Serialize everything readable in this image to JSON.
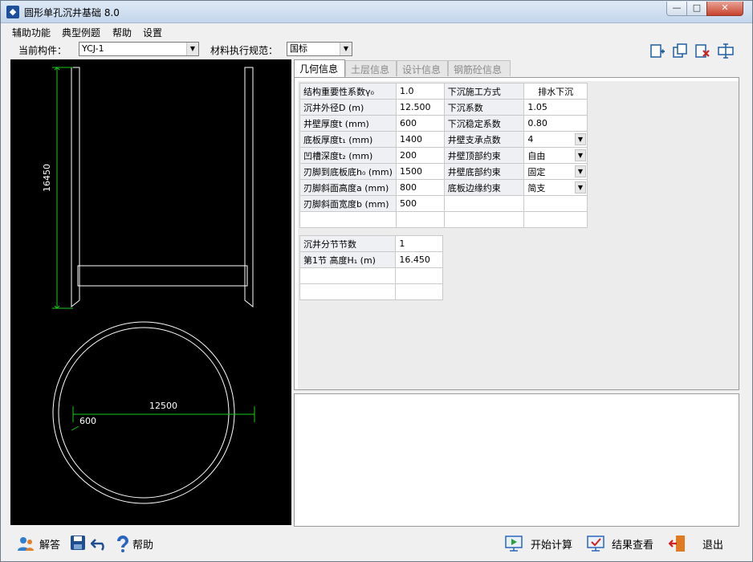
{
  "window": {
    "title": "圆形单孔沉井基础 8.0"
  },
  "menu": [
    "辅助功能",
    "典型例题",
    "帮助",
    "设置"
  ],
  "toolbar": {
    "component_label": "当前构件：",
    "component_value": "YCJ-1",
    "code_label": "材料执行规范：",
    "code_value": "国标"
  },
  "tabs": [
    "几何信息",
    "土层信息",
    "设计信息",
    "钢筋砼信息"
  ],
  "geometry_left": [
    {
      "label": "结构重要性系数γ₀",
      "value": "1.0"
    },
    {
      "label": "沉井外径D (m)",
      "value": "12.500"
    },
    {
      "label": "井壁厚度t (mm)",
      "value": "600"
    },
    {
      "label": "底板厚度t₁ (mm)",
      "value": "1400"
    },
    {
      "label": "凹槽深度t₂ (mm)",
      "value": "200"
    },
    {
      "label": "刃脚到底板底h₀ (mm)",
      "value": "1500"
    },
    {
      "label": "刃脚斜面高度a (mm)",
      "value": "800"
    },
    {
      "label": "刃脚斜面宽度b (mm)",
      "value": "500"
    }
  ],
  "geometry_right": [
    {
      "label": "下沉施工方式",
      "value": "排水下沉",
      "dropdown": false
    },
    {
      "label": "下沉系数",
      "value": "1.05",
      "dropdown": false
    },
    {
      "label": "下沉稳定系数",
      "value": "0.80",
      "dropdown": false
    },
    {
      "label": "井壁支承点数",
      "value": "4",
      "dropdown": true
    },
    {
      "label": "井壁顶部约束",
      "value": "自由",
      "dropdown": true
    },
    {
      "label": "井壁底部约束",
      "value": "固定",
      "dropdown": true
    },
    {
      "label": "底板边缘约束",
      "value": "简支",
      "dropdown": true
    }
  ],
  "sections": {
    "count_label": "沉井分节节数",
    "count_value": "1",
    "rows": [
      {
        "label": "第1节  高度H₁ (m)",
        "value": "16.450"
      }
    ]
  },
  "drawing": {
    "height_dim": "16450",
    "diameter_dim": "12500",
    "wall_dim": "600"
  },
  "bottom_buttons": {
    "answer": "解答",
    "help": "帮助",
    "start_calc": "开始计算",
    "view_result": "结果查看",
    "exit": "退出"
  }
}
